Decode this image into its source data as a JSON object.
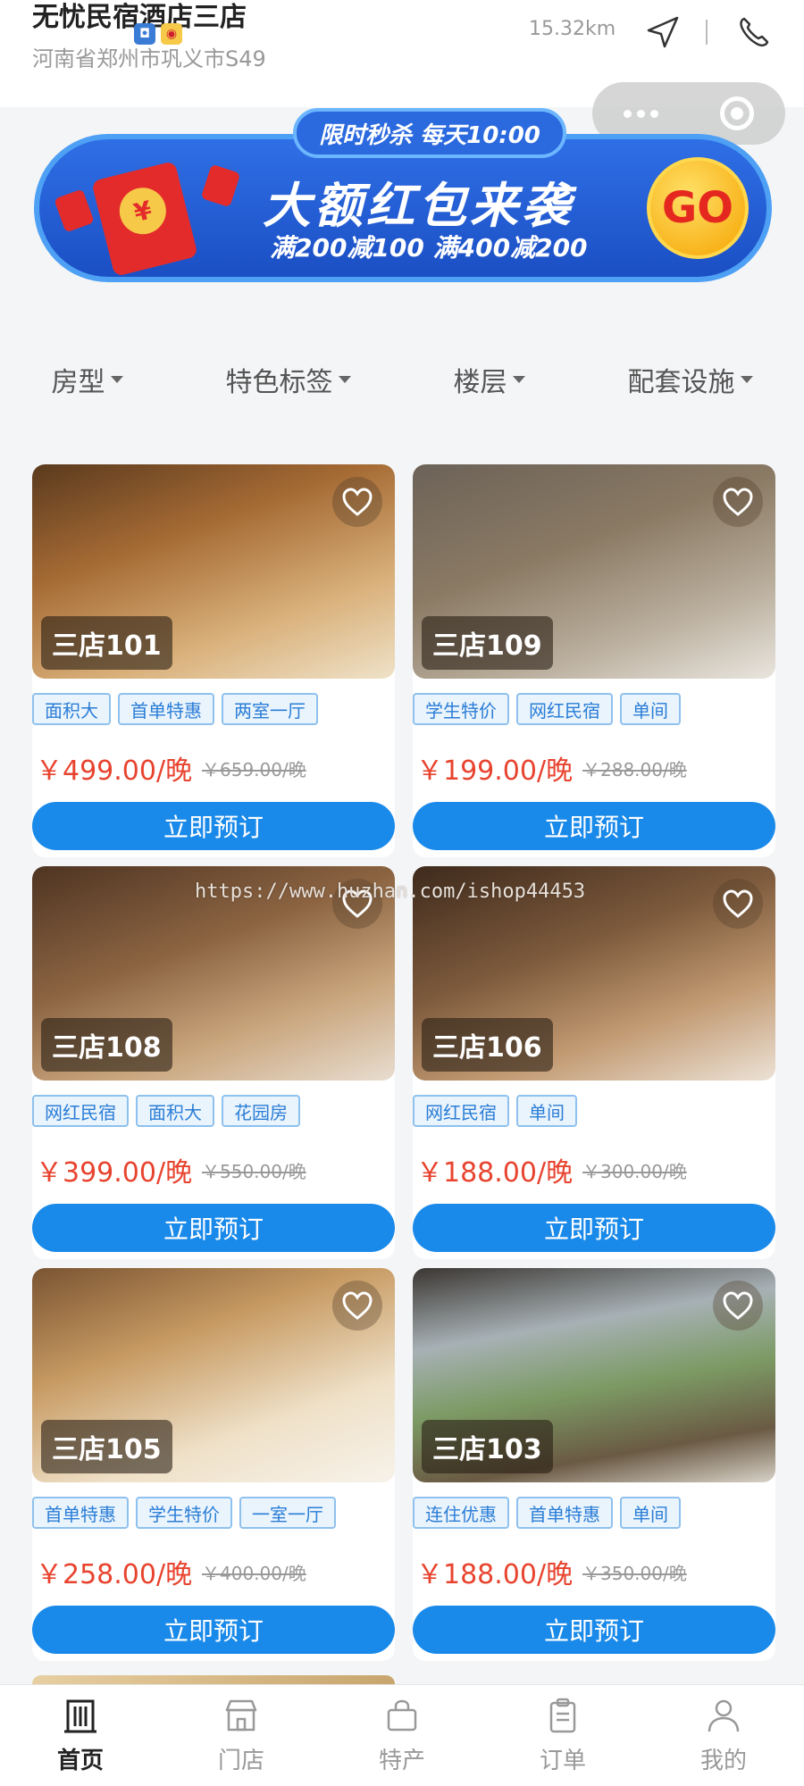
{
  "header": {
    "store_name": "无忧民宿酒店三店",
    "address": "河南省郑州市巩义市S49",
    "distance": "15.32km",
    "nav_icon": "navigate-arrow-icon",
    "phone_icon": "phone-icon"
  },
  "banner": {
    "top_label": "限时秒杀 每天10:00",
    "headline": "大额红包来袭",
    "subline": "满200减100 满400减200",
    "go_label": "GO",
    "colors": {
      "bg": "#1b4fc4",
      "border": "#4ea0f5",
      "go": "#f5a300"
    }
  },
  "filters": [
    {
      "label": "房型"
    },
    {
      "label": "特色标签"
    },
    {
      "label": "楼层"
    },
    {
      "label": "配套设施"
    }
  ],
  "rooms": [
    {
      "name": "三店101",
      "tags": [
        "面积大",
        "首单特惠",
        "两室一厅"
      ],
      "price": "￥499.00/晚",
      "orig_price": "￥659.00/晚",
      "button": "立即预订"
    },
    {
      "name": "三店109",
      "tags": [
        "学生特价",
        "网红民宿",
        "单间"
      ],
      "price": "￥199.00/晚",
      "orig_price": "￥288.00/晚",
      "button": "立即预订"
    },
    {
      "name": "三店108",
      "tags": [
        "网红民宿",
        "面积大",
        "花园房"
      ],
      "price": "￥399.00/晚",
      "orig_price": "￥550.00/晚",
      "button": "立即预订"
    },
    {
      "name": "三店106",
      "tags": [
        "网红民宿",
        "单间"
      ],
      "price": "￥188.00/晚",
      "orig_price": "￥300.00/晚",
      "button": "立即预订"
    },
    {
      "name": "三店105",
      "tags": [
        "首单特惠",
        "学生特价",
        "一室一厅"
      ],
      "price": "￥258.00/晚",
      "orig_price": "￥400.00/晚",
      "button": "立即预订"
    },
    {
      "name": "三店103",
      "tags": [
        "连住优惠",
        "首单特惠",
        "单间"
      ],
      "price": "￥188.00/晚",
      "orig_price": "￥350.00/晚",
      "button": "立即预订"
    }
  ],
  "watermark": "https://www.huzhan.com/ishop44453",
  "tabbar": [
    {
      "label": "首页",
      "icon": "building-icon",
      "active": true
    },
    {
      "label": "门店",
      "icon": "store-icon",
      "active": false
    },
    {
      "label": "特产",
      "icon": "shopping-bag-icon",
      "active": false
    },
    {
      "label": "订单",
      "icon": "clipboard-icon",
      "active": false
    },
    {
      "label": "我的",
      "icon": "user-icon",
      "active": false
    }
  ],
  "colors": {
    "accent": "#1a8aea",
    "price": "#e8432e",
    "tag_border": "#8ec1ee"
  }
}
